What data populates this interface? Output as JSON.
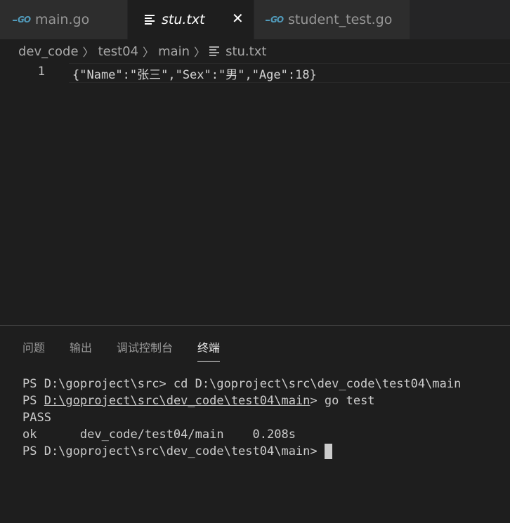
{
  "tabs": [
    {
      "label": "main.go",
      "icon": "go-file-icon",
      "active": false
    },
    {
      "label": "stu.txt",
      "icon": "text-file-icon",
      "active": true
    },
    {
      "label": "student_test.go",
      "icon": "go-file-icon",
      "active": false
    }
  ],
  "breadcrumb": {
    "items": [
      "dev_code",
      "test04",
      "main"
    ],
    "file": "stu.txt"
  },
  "editor": {
    "line_number": "1",
    "code": "{\"Name\":\"张三\",\"Sex\":\"男\",\"Age\":18}"
  },
  "panel": {
    "tabs": [
      "问题",
      "输出",
      "调试控制台",
      "终端"
    ],
    "active_tab": "终端"
  },
  "terminal": {
    "line1": "PS D:\\goproject\\src> cd D:\\goproject\\src\\dev_code\\test04\\main",
    "line2_prefix": "PS ",
    "line2_path": "D:\\goproject\\src\\dev_code\\test04\\main",
    "line2_suffix": "> go test",
    "line3": "PASS",
    "line4": "ok      dev_code/test04/main    0.208s",
    "line5": "PS D:\\goproject\\src\\dev_code\\test04\\main>"
  },
  "colors": {
    "background": "#1e1e1e",
    "tab_bar": "#252526",
    "go_icon": "#519aba",
    "text": "#cccccc"
  }
}
